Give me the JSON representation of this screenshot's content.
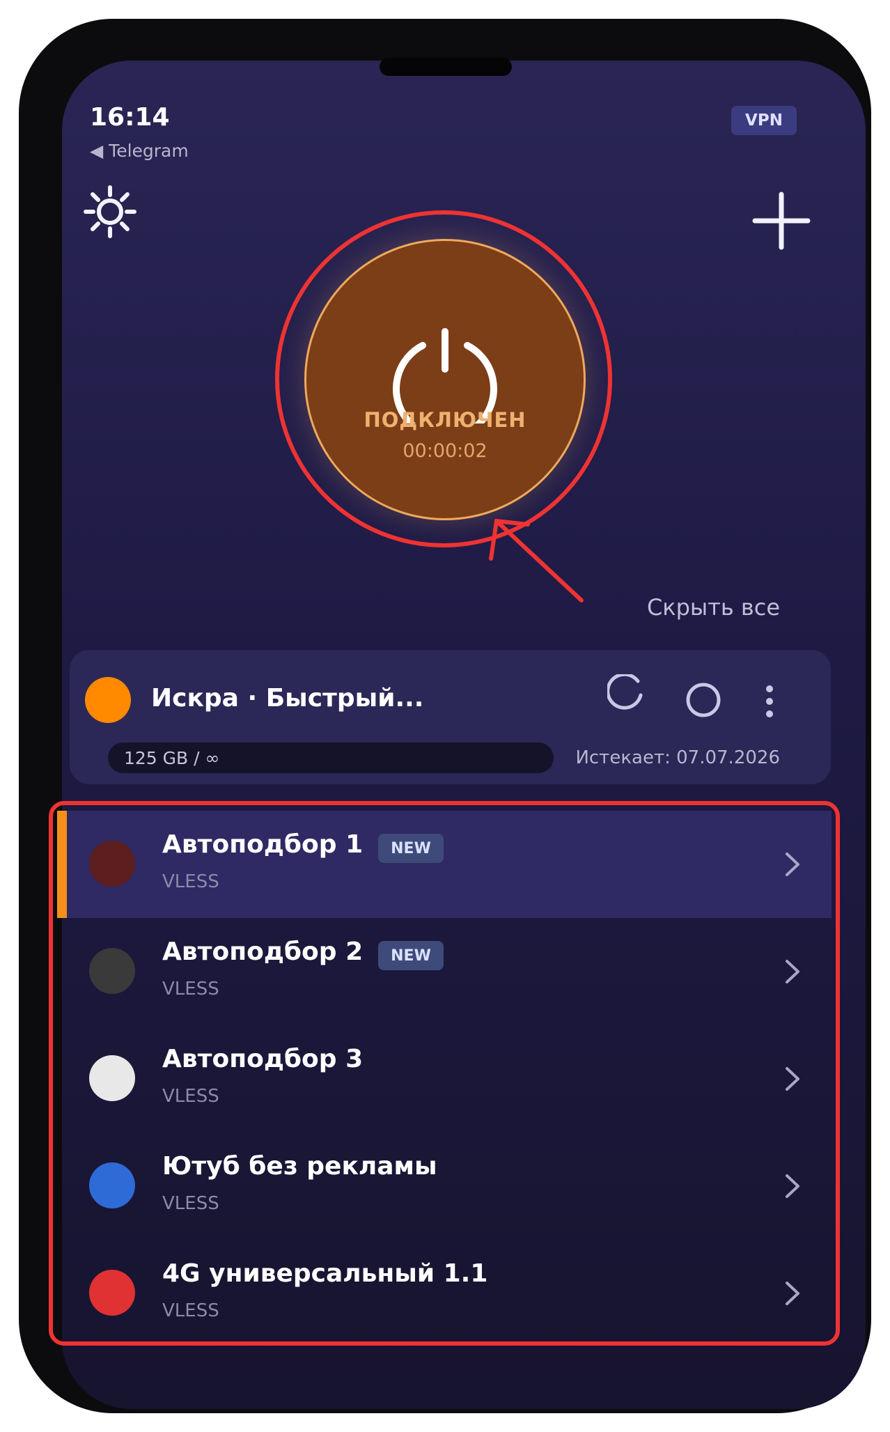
{
  "status_bar": {
    "time": "16:14",
    "back_app": "◀ Telegram",
    "vpn_badge": "VPN"
  },
  "connection": {
    "status": "ПОДКЛЮЧЕН",
    "timer": "00:00:02"
  },
  "hide_all_label": "Скрыть все",
  "subscription": {
    "title": "Искра · Быстрый...",
    "traffic": "125 GB / ∞",
    "expires": "Истекает: 07.07.2026",
    "dot_color": "#ff8a00"
  },
  "servers": [
    {
      "name": "Автоподбор 1",
      "protocol": "VLESS",
      "badge": "NEW",
      "color": "#5c1e1e",
      "active": true
    },
    {
      "name": "Автоподбор 2",
      "protocol": "VLESS",
      "badge": "NEW",
      "color": "#3a3a3a",
      "active": false
    },
    {
      "name": "Автоподбор 3",
      "protocol": "VLESS",
      "badge": "",
      "color": "#e8e8e8",
      "active": false
    },
    {
      "name": "Ютуб без рекламы",
      "protocol": "VLESS",
      "badge": "",
      "color": "#2e6bd6",
      "active": false
    },
    {
      "name": "4G универсальный 1.1",
      "protocol": "VLESS",
      "badge": "",
      "color": "#e03232",
      "active": false
    }
  ],
  "colors": {
    "accent": "#f4901a",
    "connected": "#7b3e17",
    "annotation": "#ee3333"
  },
  "icons": [
    "settings-icon",
    "add-icon",
    "power-icon",
    "refresh-icon",
    "toggle-icon",
    "more-icon",
    "chevron-right-icon"
  ]
}
